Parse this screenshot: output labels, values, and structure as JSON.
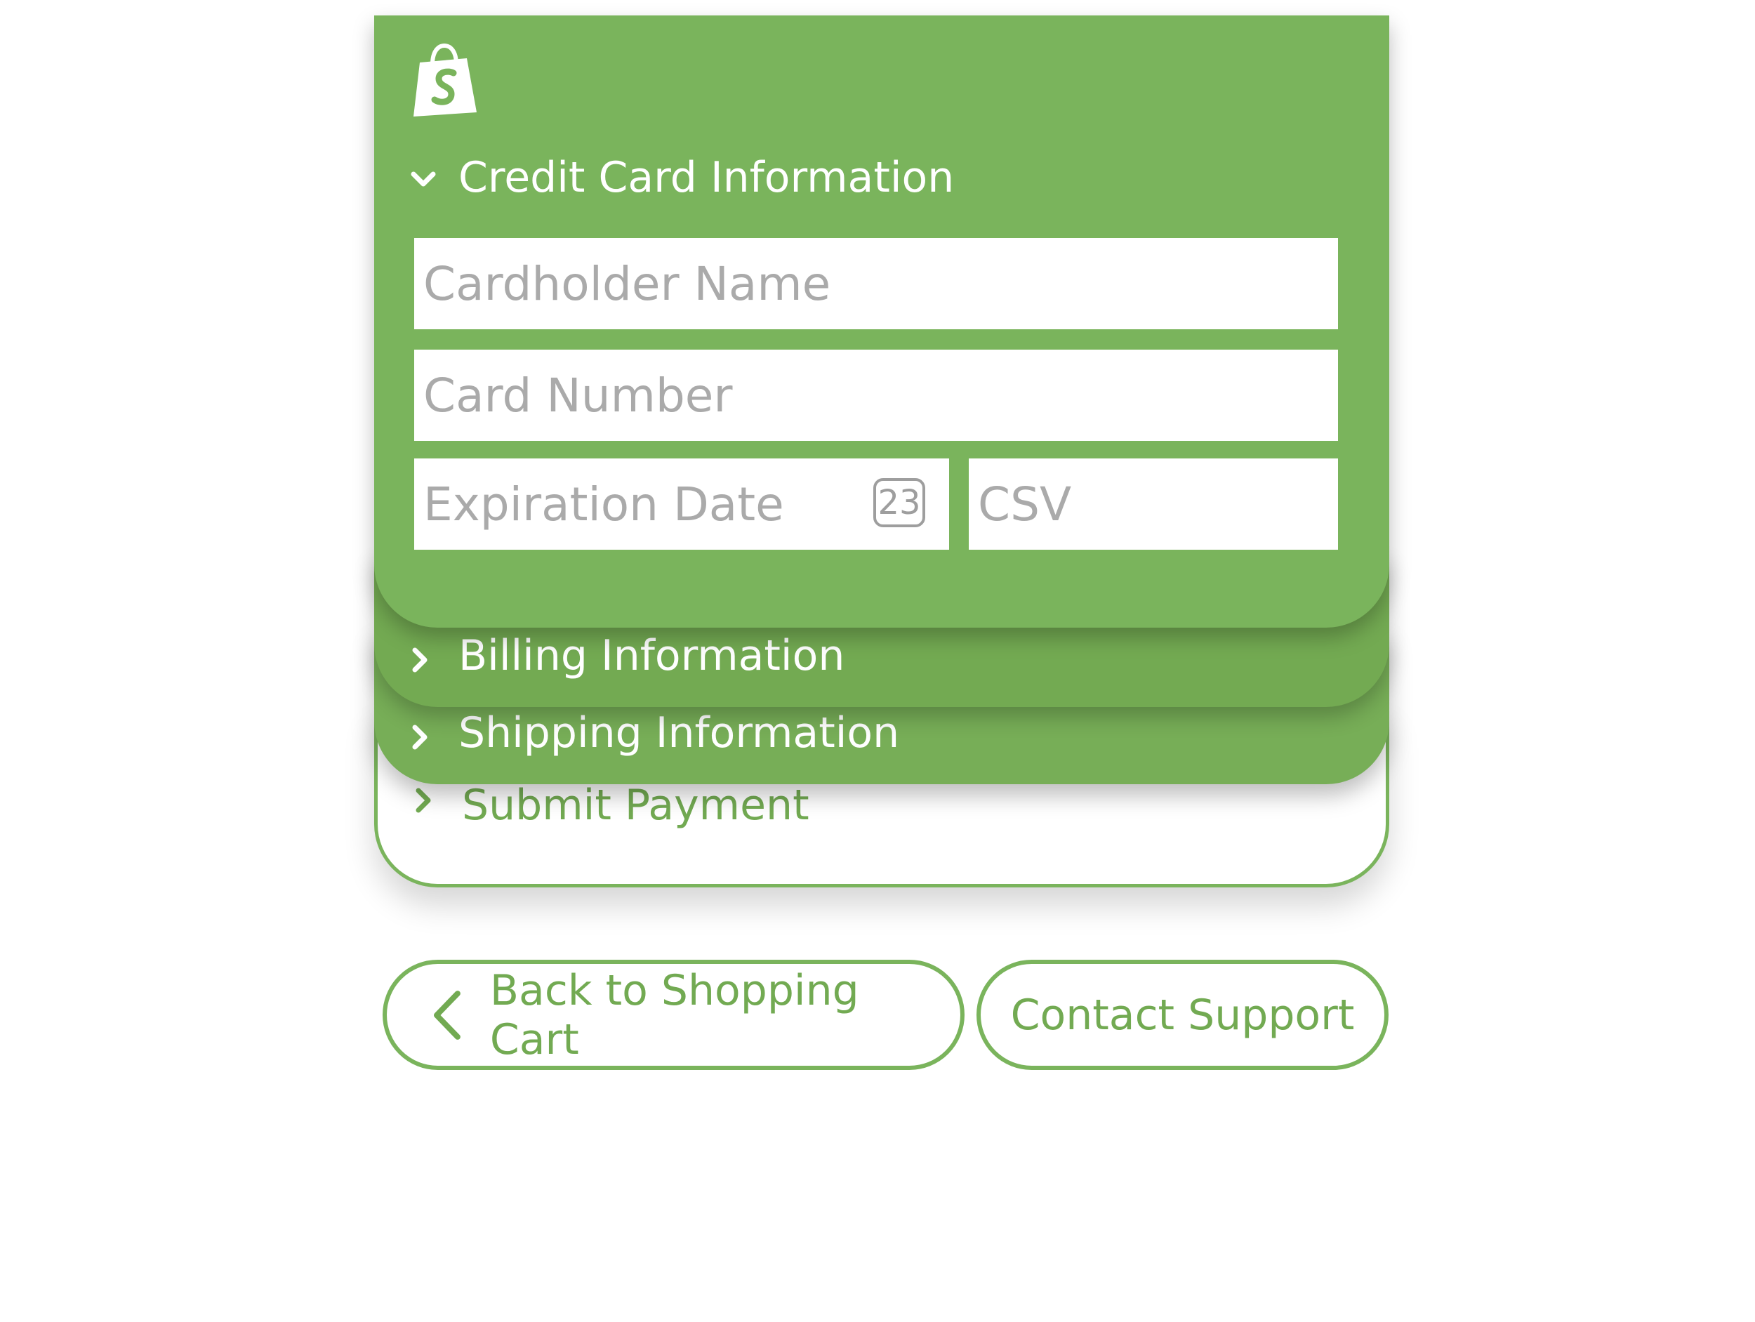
{
  "colors": {
    "brand_green": "#7ab45c",
    "text_green": "#72aa52",
    "field_bg": "#ffffff",
    "placeholder": "#aaaaaa"
  },
  "checkout": {
    "logo_icon": "shopify-bag-icon",
    "credit_card": {
      "title": "Credit Card Information",
      "expanded": true,
      "cardholder_placeholder": "Cardholder Name",
      "card_number_placeholder": "Card Number",
      "expiration_placeholder": "Expiration Date",
      "calendar_day": "23",
      "csv_placeholder": "CSV"
    },
    "billing": {
      "title": "Billing Information"
    },
    "shipping": {
      "title": "Shipping Information"
    },
    "submit": {
      "title": "Submit Payment"
    }
  },
  "actions": {
    "back_label": "Back to Shopping Cart",
    "contact_label": "Contact Support"
  }
}
